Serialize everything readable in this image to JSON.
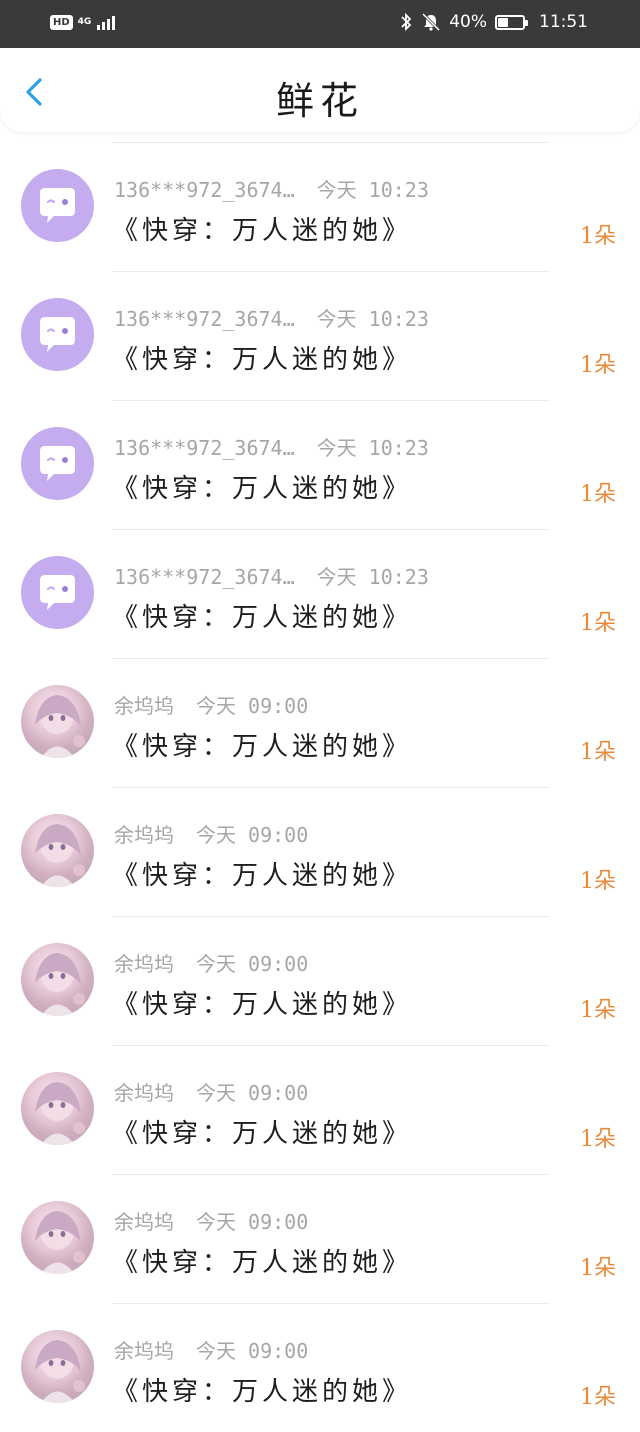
{
  "status_bar": {
    "hd": "HD",
    "network": "4G",
    "battery_text": "40%",
    "battery_level": 0.4,
    "time": "11:51"
  },
  "header": {
    "title": "鲜花"
  },
  "colors": {
    "accent_back": "#2aa3e6",
    "count_color": "#e98a3a",
    "avatar_default_bg": "#c5acef"
  },
  "rows": [
    {
      "user": "136***972_3674…",
      "time": "今天 10:23",
      "title": "《快穿：万人迷的她》",
      "count": "1朵",
      "avatar": "default-chat-icon"
    },
    {
      "user": "136***972_3674…",
      "time": "今天 10:23",
      "title": "《快穿：万人迷的她》",
      "count": "1朵",
      "avatar": "default-chat-icon"
    },
    {
      "user": "136***972_3674…",
      "time": "今天 10:23",
      "title": "《快穿：万人迷的她》",
      "count": "1朵",
      "avatar": "default-chat-icon"
    },
    {
      "user": "136***972_3674…",
      "time": "今天 10:23",
      "title": "《快穿：万人迷的她》",
      "count": "1朵",
      "avatar": "default-chat-icon"
    },
    {
      "user": "余坞坞",
      "time": "今天 09:00",
      "title": "《快穿：万人迷的她》",
      "count": "1朵",
      "avatar": "anime-girl-photo"
    },
    {
      "user": "余坞坞",
      "time": "今天 09:00",
      "title": "《快穿：万人迷的她》",
      "count": "1朵",
      "avatar": "anime-girl-photo"
    },
    {
      "user": "余坞坞",
      "time": "今天 09:00",
      "title": "《快穿：万人迷的她》",
      "count": "1朵",
      "avatar": "anime-girl-photo"
    },
    {
      "user": "余坞坞",
      "time": "今天 09:00",
      "title": "《快穿：万人迷的她》",
      "count": "1朵",
      "avatar": "anime-girl-photo"
    },
    {
      "user": "余坞坞",
      "time": "今天 09:00",
      "title": "《快穿：万人迷的她》",
      "count": "1朵",
      "avatar": "anime-girl-photo"
    },
    {
      "user": "余坞坞",
      "time": "今天 09:00",
      "title": "《快穿：万人迷的她》",
      "count": "1朵",
      "avatar": "anime-girl-photo"
    }
  ]
}
